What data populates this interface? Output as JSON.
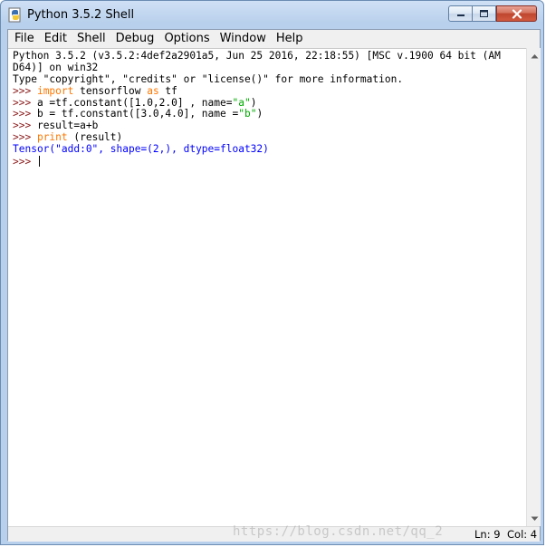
{
  "window": {
    "title": "Python 3.5.2 Shell",
    "minimize_icon": "minimize-icon",
    "maximize_icon": "maximize-icon",
    "close_icon": "close-icon"
  },
  "menu": [
    "File",
    "Edit",
    "Shell",
    "Debug",
    "Options",
    "Window",
    "Help"
  ],
  "editor": {
    "banner_line1": "Python 3.5.2 (v3.5.2:4def2a2901a5, Jun 25 2016, 22:18:55) [MSC v.1900 64 bit (AM",
    "banner_line2": "D64)] on win32",
    "banner_line3": "Type \"copyright\", \"credits\" or \"license()\" for more information.",
    "prompt": ">>> ",
    "line4_kw1": "import",
    "line4_mid": " tensorflow ",
    "line4_kw2": "as",
    "line4_end": " tf",
    "line5_a": "a =tf.constant([1.0,2.0] , name=",
    "line5_str": "\"a\"",
    "line5_end": ")",
    "line6_a": "b = tf.constant([3.0,4.0], name =",
    "line6_str": "\"b\"",
    "line6_end": ")",
    "line7": "result=a+b",
    "line8_kw": "print",
    "line8_end": " (result)",
    "output": "Tensor(\"add:0\", shape=(2,), dtype=float32)"
  },
  "status": {
    "ln": "Ln: 9",
    "col": "Col: 4"
  },
  "watermark": "https://blog.csdn.net/qq_2"
}
